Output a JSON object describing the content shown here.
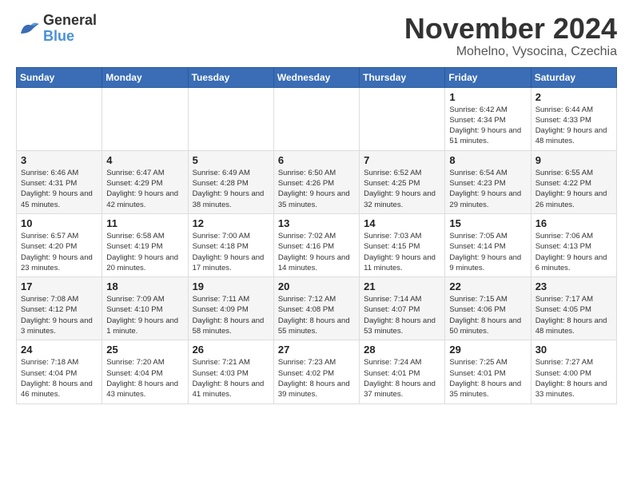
{
  "logo": {
    "text_general": "General",
    "text_blue": "Blue"
  },
  "title": "November 2024",
  "location": "Mohelno, Vysocina, Czechia",
  "days_of_week": [
    "Sunday",
    "Monday",
    "Tuesday",
    "Wednesday",
    "Thursday",
    "Friday",
    "Saturday"
  ],
  "weeks": [
    [
      {
        "day": "",
        "info": ""
      },
      {
        "day": "",
        "info": ""
      },
      {
        "day": "",
        "info": ""
      },
      {
        "day": "",
        "info": ""
      },
      {
        "day": "",
        "info": ""
      },
      {
        "day": "1",
        "info": "Sunrise: 6:42 AM\nSunset: 4:34 PM\nDaylight: 9 hours and 51 minutes."
      },
      {
        "day": "2",
        "info": "Sunrise: 6:44 AM\nSunset: 4:33 PM\nDaylight: 9 hours and 48 minutes."
      }
    ],
    [
      {
        "day": "3",
        "info": "Sunrise: 6:46 AM\nSunset: 4:31 PM\nDaylight: 9 hours and 45 minutes."
      },
      {
        "day": "4",
        "info": "Sunrise: 6:47 AM\nSunset: 4:29 PM\nDaylight: 9 hours and 42 minutes."
      },
      {
        "day": "5",
        "info": "Sunrise: 6:49 AM\nSunset: 4:28 PM\nDaylight: 9 hours and 38 minutes."
      },
      {
        "day": "6",
        "info": "Sunrise: 6:50 AM\nSunset: 4:26 PM\nDaylight: 9 hours and 35 minutes."
      },
      {
        "day": "7",
        "info": "Sunrise: 6:52 AM\nSunset: 4:25 PM\nDaylight: 9 hours and 32 minutes."
      },
      {
        "day": "8",
        "info": "Sunrise: 6:54 AM\nSunset: 4:23 PM\nDaylight: 9 hours and 29 minutes."
      },
      {
        "day": "9",
        "info": "Sunrise: 6:55 AM\nSunset: 4:22 PM\nDaylight: 9 hours and 26 minutes."
      }
    ],
    [
      {
        "day": "10",
        "info": "Sunrise: 6:57 AM\nSunset: 4:20 PM\nDaylight: 9 hours and 23 minutes."
      },
      {
        "day": "11",
        "info": "Sunrise: 6:58 AM\nSunset: 4:19 PM\nDaylight: 9 hours and 20 minutes."
      },
      {
        "day": "12",
        "info": "Sunrise: 7:00 AM\nSunset: 4:18 PM\nDaylight: 9 hours and 17 minutes."
      },
      {
        "day": "13",
        "info": "Sunrise: 7:02 AM\nSunset: 4:16 PM\nDaylight: 9 hours and 14 minutes."
      },
      {
        "day": "14",
        "info": "Sunrise: 7:03 AM\nSunset: 4:15 PM\nDaylight: 9 hours and 11 minutes."
      },
      {
        "day": "15",
        "info": "Sunrise: 7:05 AM\nSunset: 4:14 PM\nDaylight: 9 hours and 9 minutes."
      },
      {
        "day": "16",
        "info": "Sunrise: 7:06 AM\nSunset: 4:13 PM\nDaylight: 9 hours and 6 minutes."
      }
    ],
    [
      {
        "day": "17",
        "info": "Sunrise: 7:08 AM\nSunset: 4:12 PM\nDaylight: 9 hours and 3 minutes."
      },
      {
        "day": "18",
        "info": "Sunrise: 7:09 AM\nSunset: 4:10 PM\nDaylight: 9 hours and 1 minute."
      },
      {
        "day": "19",
        "info": "Sunrise: 7:11 AM\nSunset: 4:09 PM\nDaylight: 8 hours and 58 minutes."
      },
      {
        "day": "20",
        "info": "Sunrise: 7:12 AM\nSunset: 4:08 PM\nDaylight: 8 hours and 55 minutes."
      },
      {
        "day": "21",
        "info": "Sunrise: 7:14 AM\nSunset: 4:07 PM\nDaylight: 8 hours and 53 minutes."
      },
      {
        "day": "22",
        "info": "Sunrise: 7:15 AM\nSunset: 4:06 PM\nDaylight: 8 hours and 50 minutes."
      },
      {
        "day": "23",
        "info": "Sunrise: 7:17 AM\nSunset: 4:05 PM\nDaylight: 8 hours and 48 minutes."
      }
    ],
    [
      {
        "day": "24",
        "info": "Sunrise: 7:18 AM\nSunset: 4:04 PM\nDaylight: 8 hours and 46 minutes."
      },
      {
        "day": "25",
        "info": "Sunrise: 7:20 AM\nSunset: 4:04 PM\nDaylight: 8 hours and 43 minutes."
      },
      {
        "day": "26",
        "info": "Sunrise: 7:21 AM\nSunset: 4:03 PM\nDaylight: 8 hours and 41 minutes."
      },
      {
        "day": "27",
        "info": "Sunrise: 7:23 AM\nSunset: 4:02 PM\nDaylight: 8 hours and 39 minutes."
      },
      {
        "day": "28",
        "info": "Sunrise: 7:24 AM\nSunset: 4:01 PM\nDaylight: 8 hours and 37 minutes."
      },
      {
        "day": "29",
        "info": "Sunrise: 7:25 AM\nSunset: 4:01 PM\nDaylight: 8 hours and 35 minutes."
      },
      {
        "day": "30",
        "info": "Sunrise: 7:27 AM\nSunset: 4:00 PM\nDaylight: 8 hours and 33 minutes."
      }
    ]
  ]
}
